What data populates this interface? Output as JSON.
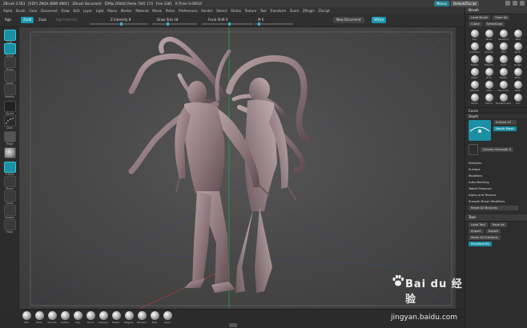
{
  "app": {
    "title_bar": [
      "ZBrush 3.5R3",
      "[RDY1 ZNQA 4BNX 4N0C]",
      "ZBrush Document",
      "[DMja 26046] Rema 7841 174",
      "Free 3381",
      "R.Timer 0.00614"
    ],
    "quicksave_label": "Menus",
    "default_script_label": "DefaultZScript"
  },
  "menu": {
    "items": [
      "Alpha",
      "Brush",
      "Color",
      "Document",
      "Draw",
      "Edit",
      "Layer",
      "Light",
      "Macro",
      "Marker",
      "Material",
      "Movie",
      "Picker",
      "Preferences",
      "Render",
      "Stencil",
      "Stroke",
      "Texture",
      "Tool",
      "Transform",
      "Zoom",
      "ZPlugin",
      "ZScript"
    ]
  },
  "toolbar": {
    "rgb_label": "Rgb",
    "zadd_label": "Zadd",
    "zsub_label": "Zsub",
    "rgb_intensity_label": "Rgb Intensity",
    "z_intensity_label": "Z Intensity 8",
    "draw_size_label": "Draw Size 18",
    "focal_shift_label": "Focal Shift 0",
    "m_label": "M 0",
    "new_document_label": "New Document",
    "wsize_label": "WSize"
  },
  "left_shelf": {
    "labels": [
      "Edit",
      "Draw",
      "Move",
      "Scale",
      "Rotate",
      "Alpha",
      "Dots",
      "Mrgb",
      "Frame",
      "Move",
      "Scale",
      "Rotate",
      "Floor"
    ]
  },
  "brush_palette": {
    "header": "Brush",
    "load_brush": "Load Brush",
    "save_as": "Save As",
    "clone": "Clone",
    "select_icon": "SelectIcon",
    "brushes": [
      "Clay",
      "Move",
      "Standard",
      "Inflat",
      "ClayTube",
      "Smooth",
      "Inflat",
      "Pinch",
      "Flatten",
      "Magnify",
      "Layer",
      "Nudge",
      "Polish",
      "Blob",
      "Elastic",
      "Pinch",
      "ZProject",
      "Slide",
      "ClipCurve",
      "Mask",
      "Morph",
      "Planar",
      "DamStandard",
      "Trim"
    ],
    "curve_label": "Curve",
    "depth_label": "Depth",
    "embed_label": "Embed 97",
    "depth_mask_label": "Depth Mask",
    "gravity_label": "Gravity Strength 0",
    "sections": [
      "Samples",
      "Surface",
      "Modifiers",
      "Auto Masking",
      "Tablet Pressure",
      "Alpha and Texture",
      "Smooth Brush Modifiers"
    ],
    "reset_label": "Reset All Brushes"
  },
  "tool_palette": {
    "header": "Tool",
    "load_tool": "Load Tool",
    "save_as": "Save As",
    "import_label": "Import",
    "export_label": "Export",
    "subtools_label": "Make All SubTools",
    "polymesh_label": "PolyMesh3D"
  },
  "bottom_brushes": [
    "Std",
    "Move",
    "Smooth",
    "Flatten",
    "Clay",
    "Pinch",
    "Displace",
    "Elastic",
    "Magnify",
    "ZProject",
    "Blob",
    "Layer"
  ],
  "watermark": {
    "brand": "Bai du 经验",
    "url": "jingyan.baidu.com"
  }
}
